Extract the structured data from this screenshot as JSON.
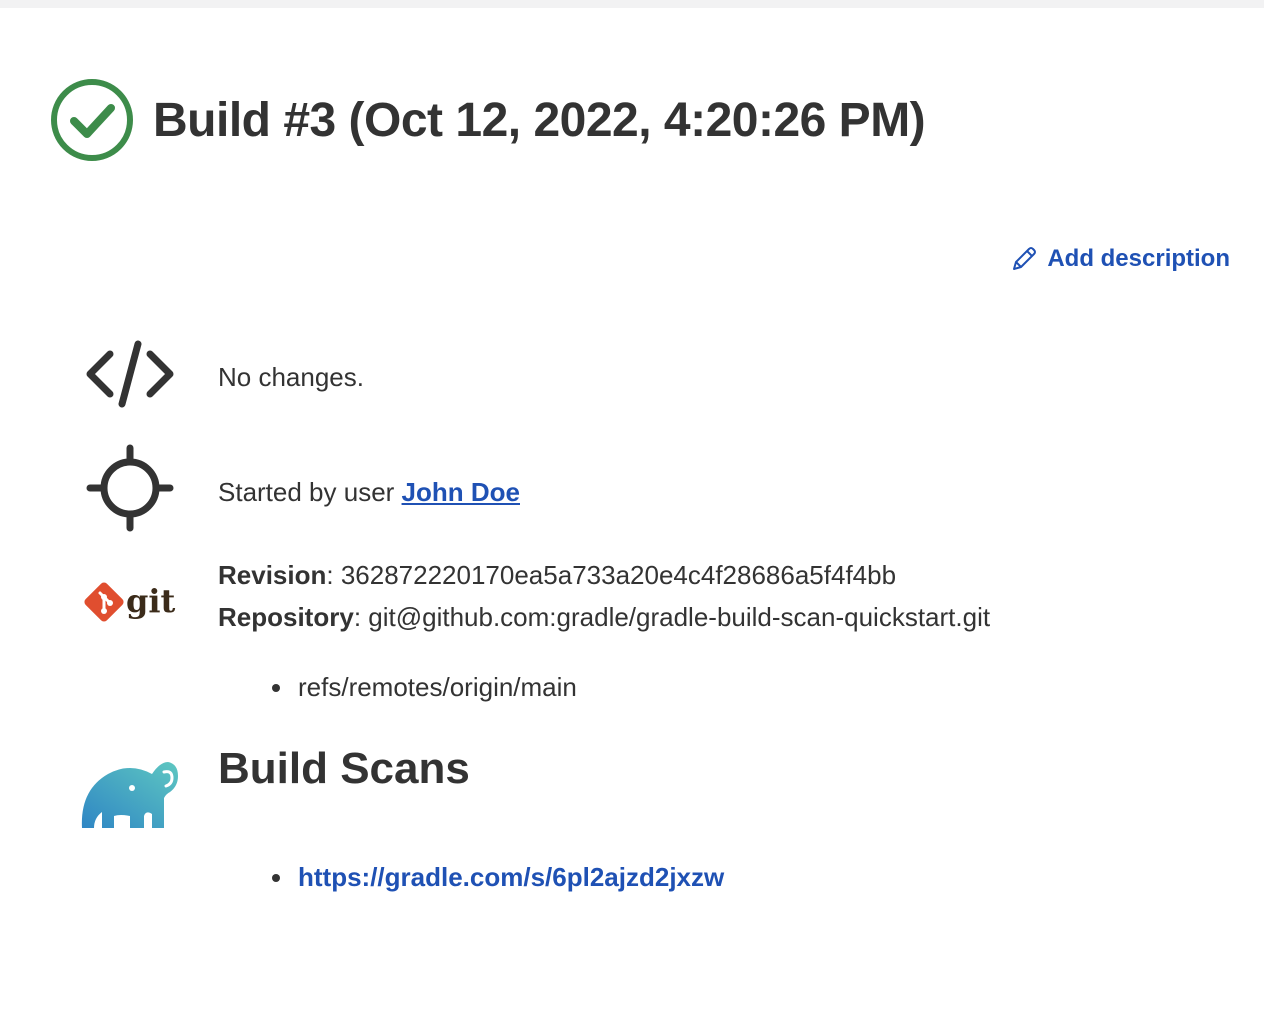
{
  "build": {
    "title": "Build #3 (Oct 12, 2022, 4:20:26 PM)",
    "status": "success",
    "status_color": "#3d8c4a"
  },
  "actions": {
    "add_description": "Add description"
  },
  "changes": {
    "text": "No changes."
  },
  "cause": {
    "prefix": "Started by user ",
    "user": "John Doe"
  },
  "git": {
    "logo_text": "git",
    "revision_label": "Revision",
    "revision": "362872220170ea5a733a20e4c4f28686a5f4f4bb",
    "repository_label": "Repository",
    "repository": "git@github.com:gradle/gradle-build-scan-quickstart.git",
    "branches": [
      "refs/remotes/origin/main"
    ]
  },
  "build_scans": {
    "title": "Build Scans",
    "links": [
      "https://gradle.com/s/6pl2ajzd2jxzw"
    ]
  },
  "colors": {
    "link": "#1f51b4",
    "text": "#333333",
    "git_orange": "#e04e2f"
  },
  "icons": {
    "status": "check-circle-icon",
    "edit": "pencil-icon",
    "changes": "code-icon",
    "cause": "crosshair-icon",
    "scm": "git-logo-icon",
    "build_scans": "gradle-elephant-icon"
  }
}
